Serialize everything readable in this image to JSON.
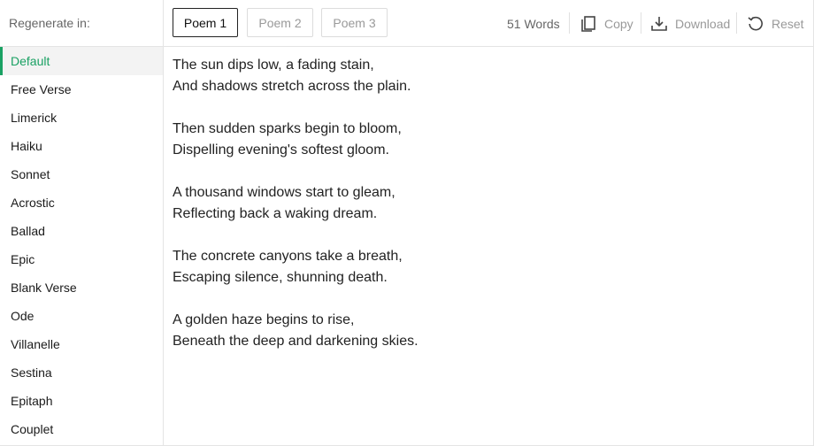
{
  "sidebar": {
    "header": "Regenerate in:",
    "active_index": 0,
    "items": [
      {
        "label": "Default"
      },
      {
        "label": "Free Verse"
      },
      {
        "label": "Limerick"
      },
      {
        "label": "Haiku"
      },
      {
        "label": "Sonnet"
      },
      {
        "label": "Acrostic"
      },
      {
        "label": "Ballad"
      },
      {
        "label": "Epic"
      },
      {
        "label": "Blank Verse"
      },
      {
        "label": "Ode"
      },
      {
        "label": "Villanelle"
      },
      {
        "label": "Sestina"
      },
      {
        "label": "Epitaph"
      },
      {
        "label": "Couplet"
      }
    ]
  },
  "tabs": [
    {
      "label": "Poem 1",
      "active": true
    },
    {
      "label": "Poem 2",
      "active": false
    },
    {
      "label": "Poem 3",
      "active": false
    }
  ],
  "toolbar": {
    "word_count": "51 Words",
    "copy_label": "Copy",
    "download_label": "Download",
    "reset_label": "Reset"
  },
  "poem": {
    "stanzas": [
      [
        "The sun dips low, a fading stain,",
        "And shadows stretch across the plain."
      ],
      [
        "Then sudden sparks begin to bloom,",
        "Dispelling evening's softest gloom."
      ],
      [
        "A thousand windows start to gleam,",
        "Reflecting back a waking dream."
      ],
      [
        "The concrete canyons take a breath,",
        "Escaping silence, shunning death."
      ],
      [
        "A golden haze begins to rise,",
        "Beneath the deep and darkening skies."
      ]
    ]
  },
  "colors": {
    "accent": "#1aa163",
    "muted_text": "#999999",
    "border": "#e4e4e4"
  }
}
